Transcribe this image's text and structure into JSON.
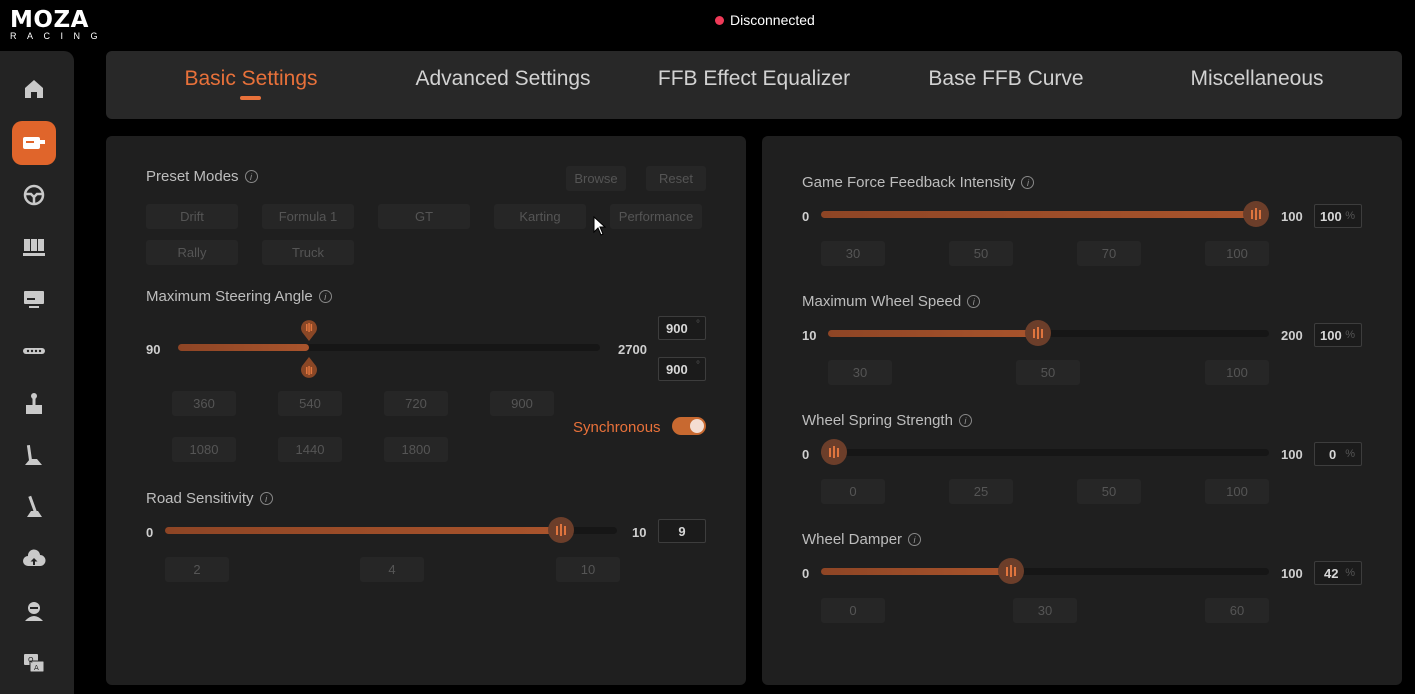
{
  "brand": {
    "logo_top": "MOZA",
    "logo_bottom": "RACING"
  },
  "status": {
    "text": "Disconnected",
    "dot_color": "#ef3a58"
  },
  "sidebar": {
    "items": [
      {
        "icon": "home-icon",
        "active": false
      },
      {
        "icon": "wheelbase-icon",
        "active": true
      },
      {
        "icon": "steering-wheel-icon",
        "active": false
      },
      {
        "icon": "pedals-icon",
        "active": false
      },
      {
        "icon": "dashboard-icon",
        "active": false
      },
      {
        "icon": "shift-lights-icon",
        "active": false
      },
      {
        "icon": "handbrake-icon",
        "active": false
      },
      {
        "icon": "shifter-icon",
        "active": false
      },
      {
        "icon": "sequential-shifter-icon",
        "active": false
      },
      {
        "icon": "cloud-upload-icon",
        "active": false
      },
      {
        "icon": "user-icon",
        "active": false
      },
      {
        "icon": "qa-icon",
        "active": false
      }
    ]
  },
  "tabs": [
    {
      "label": "Basic Settings",
      "active": true
    },
    {
      "label": "Advanced Settings",
      "active": false
    },
    {
      "label": "FFB Effect Equalizer",
      "active": false
    },
    {
      "label": "Base FFB Curve",
      "active": false
    },
    {
      "label": "Miscellaneous",
      "active": false
    }
  ],
  "left": {
    "preset": {
      "title": "Preset Modes",
      "browse": "Browse",
      "reset": "Reset",
      "modes": [
        "Drift",
        "Formula 1",
        "GT",
        "Karting",
        "Performance",
        "Rally",
        "Truck"
      ]
    },
    "steering": {
      "title": "Maximum Steering Angle",
      "min": "90",
      "max": "2700",
      "value_top": "900",
      "value_bottom": "900",
      "unit": "°",
      "value_fraction": 0.3103,
      "presets": [
        "360",
        "540",
        "720",
        "900",
        "1080",
        "1440",
        "1800"
      ],
      "sync_label": "Synchronous",
      "sync_on": true
    },
    "road": {
      "title": "Road Sensitivity",
      "min": "0",
      "max": "10",
      "value": "9",
      "value_fraction": 0.9,
      "presets": [
        "2",
        "4",
        "10"
      ]
    }
  },
  "right": {
    "ffb": {
      "title": "Game Force Feedback Intensity",
      "min": "0",
      "max": "100",
      "value": "100",
      "unit": "%",
      "value_fraction": 1.0,
      "presets": [
        "30",
        "50",
        "70",
        "100"
      ]
    },
    "wheel_speed": {
      "title": "Maximum Wheel Speed",
      "min": "10",
      "max": "200",
      "value": "100",
      "unit": "%",
      "value_fraction": 0.4737,
      "presets": [
        "30",
        "50",
        "100"
      ]
    },
    "spring": {
      "title": "Wheel Spring Strength",
      "min": "0",
      "max": "100",
      "value": "0",
      "unit": "%",
      "value_fraction": 0.0,
      "presets": [
        "0",
        "25",
        "50",
        "100"
      ]
    },
    "damper": {
      "title": "Wheel Damper",
      "min": "0",
      "max": "100",
      "value": "42",
      "unit": "%",
      "value_fraction": 0.42,
      "presets": [
        "0",
        "30",
        "60"
      ]
    }
  },
  "colors": {
    "accent": "#e8713a",
    "panel": "#1f1f1f",
    "sidebar": "#232323"
  }
}
